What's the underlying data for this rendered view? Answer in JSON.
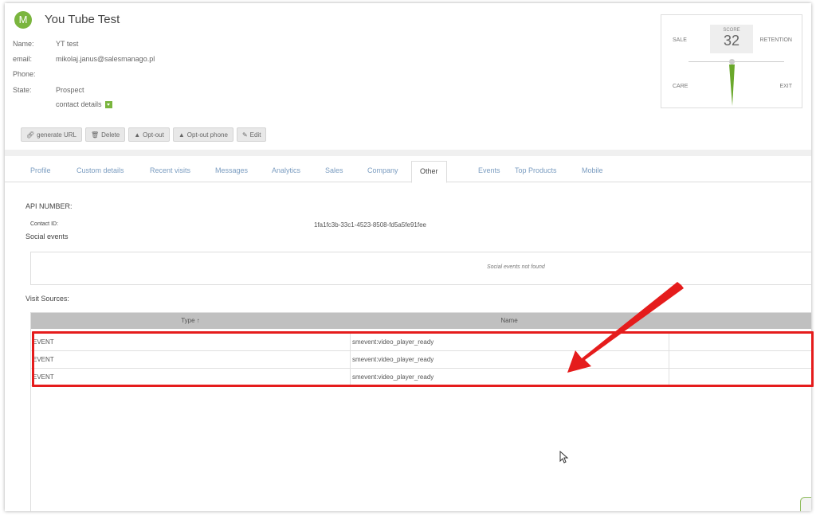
{
  "contact": {
    "initial": "M",
    "name": "You Tube Test",
    "fields": [
      {
        "label": "Name:",
        "value": "YT test"
      },
      {
        "label": "email:",
        "value": "mikolaj.janus@salesmanago.pl"
      },
      {
        "label": "Phone:",
        "value": ""
      },
      {
        "label": "State:",
        "value": "Prospect"
      }
    ],
    "details_link": "contact details"
  },
  "toolbar": {
    "generate_url": "generate URL",
    "delete": "Delete",
    "opt_out": "Opt-out",
    "opt_out_phone": "Opt-out phone",
    "edit": "Edit"
  },
  "score": {
    "title": "SCORE",
    "value": "32",
    "sale": "SALE",
    "retention": "RETENTION",
    "care": "CARE",
    "exit": "EXIT",
    "accent": "#6aa82b"
  },
  "tabs": [
    "Profile",
    "Custom details",
    "Recent visits",
    "Messages",
    "Analytics",
    "Sales",
    "Company",
    "Other",
    "Events",
    "Top Products",
    "Mobile"
  ],
  "active_tab": "Other",
  "api": {
    "title": "API NUMBER:",
    "contact_id_label": "Contact ID:",
    "contact_id_value": "1fa1fc3b-33c1-4523-8508-fd5a5fe91fee"
  },
  "social": {
    "title": "Social events",
    "empty_message": "Social events not found"
  },
  "visits": {
    "title": "Visit Sources:",
    "columns": [
      "Type ↑",
      "Name"
    ],
    "rows": [
      {
        "type": "EVENT",
        "name": "smevent:video_player_ready"
      },
      {
        "type": "EVENT",
        "name": "smevent:video_player_ready"
      },
      {
        "type": "EVENT",
        "name": "smevent:video_player_ready"
      }
    ]
  },
  "colors": {
    "highlight": "#e51c1c",
    "brand_green": "#7ab53e"
  }
}
